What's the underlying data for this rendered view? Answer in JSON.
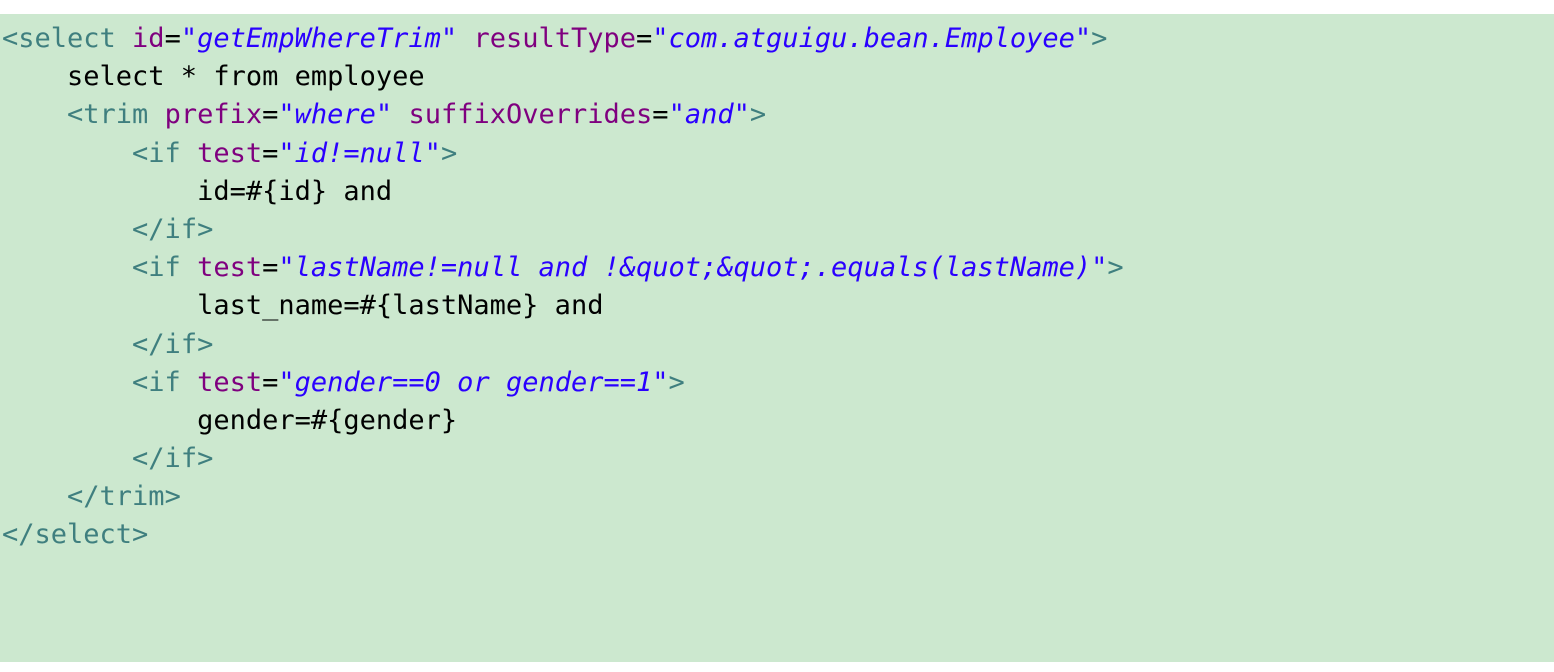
{
  "editor": {
    "background": "#cce8cf",
    "colors": {
      "tag": "#3f7f7f",
      "attribute": "#7f007f",
      "value": "#2a00ff",
      "text": "#000000"
    },
    "lines": [
      [
        {
          "t": "tag",
          "v": "<select "
        },
        {
          "t": "attr",
          "v": "id"
        },
        {
          "t": "txt",
          "v": "="
        },
        {
          "t": "val",
          "v": "\"getEmpWhereTrim\""
        },
        {
          "t": "txt",
          "v": " "
        },
        {
          "t": "attr",
          "v": "resultType"
        },
        {
          "t": "txt",
          "v": "="
        },
        {
          "t": "val",
          "v": "\"com.atguigu.bean.Employee\""
        },
        {
          "t": "tag",
          "v": ">"
        }
      ],
      [
        {
          "t": "txt",
          "v": "    select * from employee"
        }
      ],
      [
        {
          "t": "txt",
          "v": "    "
        },
        {
          "t": "tag",
          "v": "<trim "
        },
        {
          "t": "attr",
          "v": "prefix"
        },
        {
          "t": "txt",
          "v": "="
        },
        {
          "t": "val",
          "v": "\"where\""
        },
        {
          "t": "txt",
          "v": " "
        },
        {
          "t": "attr",
          "v": "suffixOverrides"
        },
        {
          "t": "txt",
          "v": "="
        },
        {
          "t": "val",
          "v": "\"and\""
        },
        {
          "t": "tag",
          "v": ">"
        }
      ],
      [
        {
          "t": "txt",
          "v": "        "
        },
        {
          "t": "tag",
          "v": "<if "
        },
        {
          "t": "attr",
          "v": "test"
        },
        {
          "t": "txt",
          "v": "="
        },
        {
          "t": "val",
          "v": "\"id!=null\""
        },
        {
          "t": "tag",
          "v": ">"
        }
      ],
      [
        {
          "t": "txt",
          "v": "            id=#{id} and"
        }
      ],
      [
        {
          "t": "txt",
          "v": "        "
        },
        {
          "t": "tag",
          "v": "</if>"
        }
      ],
      [
        {
          "t": "txt",
          "v": "        "
        },
        {
          "t": "tag",
          "v": "<if "
        },
        {
          "t": "attr",
          "v": "test"
        },
        {
          "t": "txt",
          "v": "="
        },
        {
          "t": "val",
          "v": "\"lastName!=null and !&quot;&quot;.equals(lastName)\""
        },
        {
          "t": "tag",
          "v": ">"
        }
      ],
      [
        {
          "t": "txt",
          "v": "            last_name=#{lastName} and"
        }
      ],
      [
        {
          "t": "txt",
          "v": "        "
        },
        {
          "t": "tag",
          "v": "</if>"
        }
      ],
      [
        {
          "t": "txt",
          "v": "        "
        },
        {
          "t": "tag",
          "v": "<if "
        },
        {
          "t": "attr",
          "v": "test"
        },
        {
          "t": "txt",
          "v": "="
        },
        {
          "t": "val",
          "v": "\"gender==0 or gender==1\""
        },
        {
          "t": "tag",
          "v": ">"
        }
      ],
      [
        {
          "t": "txt",
          "v": "            gender=#{gender}"
        }
      ],
      [
        {
          "t": "txt",
          "v": "        "
        },
        {
          "t": "tag",
          "v": "</if>"
        }
      ],
      [
        {
          "t": "txt",
          "v": "    "
        },
        {
          "t": "tag",
          "v": "</trim>"
        }
      ],
      [
        {
          "t": "tag",
          "v": "</select>"
        }
      ]
    ]
  }
}
